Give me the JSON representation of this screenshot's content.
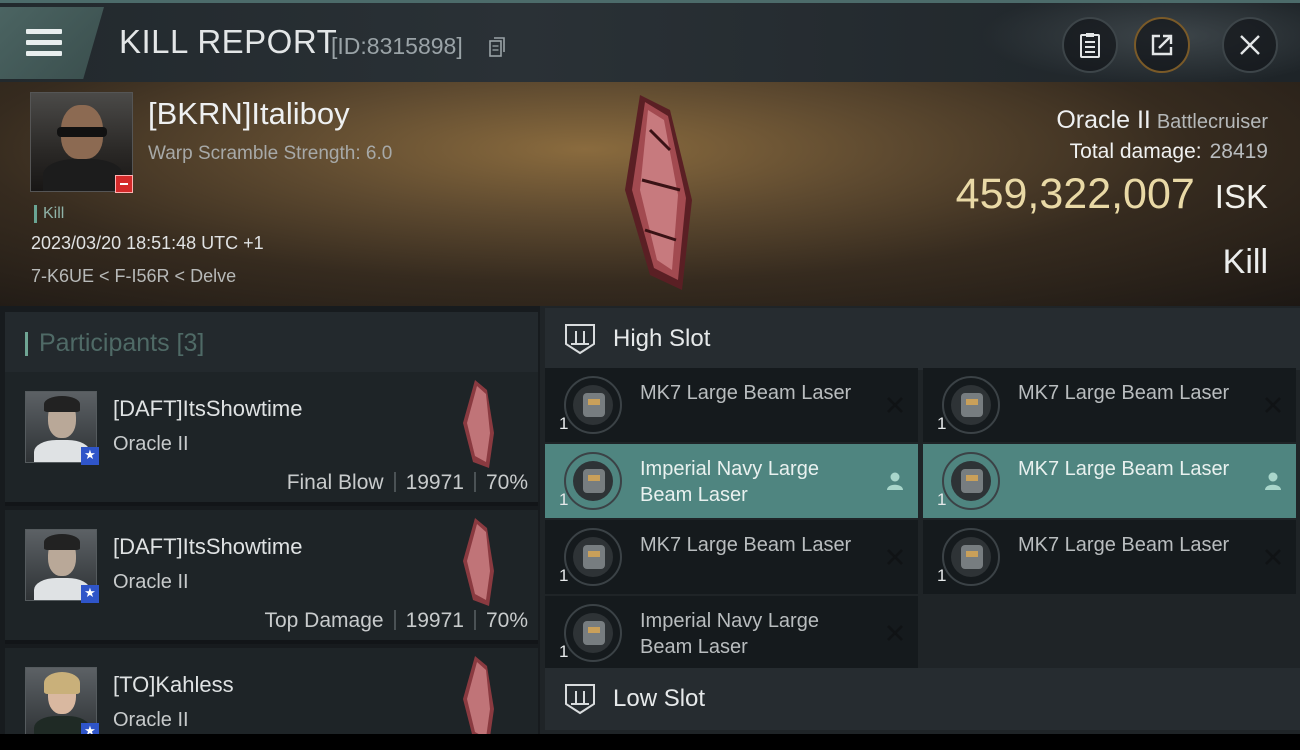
{
  "topbar": {
    "title": "KILL REPORT",
    "report_id": "[ID:8315898]",
    "icons": [
      "menu-icon",
      "copy-icon",
      "clipboard-icon",
      "share-icon",
      "close-icon"
    ]
  },
  "victim": {
    "name": "[BKRN]Italiboy",
    "warp_scramble": "Warp Scramble Strength: 6.0",
    "tag": "Kill",
    "datetime": "2023/03/20 18:51:48 UTC +1",
    "location": "7-K6UE < F-I56R < Delve",
    "ship_name": "Oracle II",
    "ship_class": "Battlecruiser",
    "total_damage_label": "Total damage:",
    "total_damage_value": "28419",
    "isk_value": "459,322,007",
    "isk_unit": "ISK",
    "result": "Kill"
  },
  "participants": {
    "header": "Participants [3]",
    "items": [
      {
        "name": "[DAFT]ItsShowtime",
        "ship": "Oracle II",
        "role": "Final Blow",
        "damage": "19971",
        "percent": "70%"
      },
      {
        "name": "[DAFT]ItsShowtime",
        "ship": "Oracle II",
        "role": "Top Damage",
        "damage": "19971",
        "percent": "70%"
      },
      {
        "name": "[TO]Kahless",
        "ship": "Oracle II",
        "role": "",
        "damage": "",
        "percent": ""
      }
    ]
  },
  "slots": {
    "high_slot_label": "High Slot",
    "low_slot_label": "Low Slot",
    "high_slot_modules": [
      {
        "name": "MK7 Large Beam Laser",
        "qty": "1",
        "status": "destroyed"
      },
      {
        "name": "MK7 Large Beam Laser",
        "qty": "1",
        "status": "destroyed"
      },
      {
        "name": "Imperial Navy Large Beam Laser",
        "qty": "1",
        "status": "dropped"
      },
      {
        "name": "MK7 Large Beam Laser",
        "qty": "1",
        "status": "dropped"
      },
      {
        "name": "MK7 Large Beam Laser",
        "qty": "1",
        "status": "destroyed"
      },
      {
        "name": "MK7 Large Beam Laser",
        "qty": "1",
        "status": "destroyed"
      },
      {
        "name": "Imperial Navy Large Beam Laser",
        "qty": "1",
        "status": "destroyed"
      }
    ]
  },
  "colors": {
    "accent": "#6fa594",
    "selected_row": "#4f8580",
    "isk": "#e9d9a6",
    "badge_red": "#d42a2a",
    "badge_blue": "#2f55c9"
  }
}
